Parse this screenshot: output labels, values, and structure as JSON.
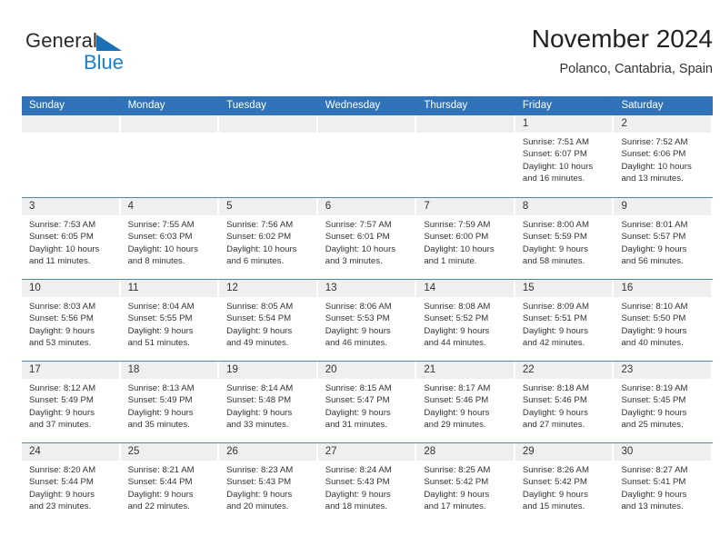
{
  "brand": {
    "name_part1": "General",
    "name_part2": "Blue",
    "triangle_color": "#1a6fb5",
    "blue_color": "#1a7fd4"
  },
  "header": {
    "title": "November 2024",
    "subtitle": "Polanco, Cantabria, Spain"
  },
  "theme": {
    "header_blue": "#3073b8",
    "row_divider": "#4f83bd",
    "daynum_band": "#efefef",
    "text": "#333333"
  },
  "weekday_headers": [
    "Sunday",
    "Monday",
    "Tuesday",
    "Wednesday",
    "Thursday",
    "Friday",
    "Saturday"
  ],
  "weeks": [
    [
      {
        "day": "",
        "lines": []
      },
      {
        "day": "",
        "lines": []
      },
      {
        "day": "",
        "lines": []
      },
      {
        "day": "",
        "lines": []
      },
      {
        "day": "",
        "lines": []
      },
      {
        "day": "1",
        "lines": [
          "Sunrise: 7:51 AM",
          "Sunset: 6:07 PM",
          "Daylight: 10 hours",
          "and 16 minutes."
        ]
      },
      {
        "day": "2",
        "lines": [
          "Sunrise: 7:52 AM",
          "Sunset: 6:06 PM",
          "Daylight: 10 hours",
          "and 13 minutes."
        ]
      }
    ],
    [
      {
        "day": "3",
        "lines": [
          "Sunrise: 7:53 AM",
          "Sunset: 6:05 PM",
          "Daylight: 10 hours",
          "and 11 minutes."
        ]
      },
      {
        "day": "4",
        "lines": [
          "Sunrise: 7:55 AM",
          "Sunset: 6:03 PM",
          "Daylight: 10 hours",
          "and 8 minutes."
        ]
      },
      {
        "day": "5",
        "lines": [
          "Sunrise: 7:56 AM",
          "Sunset: 6:02 PM",
          "Daylight: 10 hours",
          "and 6 minutes."
        ]
      },
      {
        "day": "6",
        "lines": [
          "Sunrise: 7:57 AM",
          "Sunset: 6:01 PM",
          "Daylight: 10 hours",
          "and 3 minutes."
        ]
      },
      {
        "day": "7",
        "lines": [
          "Sunrise: 7:59 AM",
          "Sunset: 6:00 PM",
          "Daylight: 10 hours",
          "and 1 minute."
        ]
      },
      {
        "day": "8",
        "lines": [
          "Sunrise: 8:00 AM",
          "Sunset: 5:59 PM",
          "Daylight: 9 hours",
          "and 58 minutes."
        ]
      },
      {
        "day": "9",
        "lines": [
          "Sunrise: 8:01 AM",
          "Sunset: 5:57 PM",
          "Daylight: 9 hours",
          "and 56 minutes."
        ]
      }
    ],
    [
      {
        "day": "10",
        "lines": [
          "Sunrise: 8:03 AM",
          "Sunset: 5:56 PM",
          "Daylight: 9 hours",
          "and 53 minutes."
        ]
      },
      {
        "day": "11",
        "lines": [
          "Sunrise: 8:04 AM",
          "Sunset: 5:55 PM",
          "Daylight: 9 hours",
          "and 51 minutes."
        ]
      },
      {
        "day": "12",
        "lines": [
          "Sunrise: 8:05 AM",
          "Sunset: 5:54 PM",
          "Daylight: 9 hours",
          "and 49 minutes."
        ]
      },
      {
        "day": "13",
        "lines": [
          "Sunrise: 8:06 AM",
          "Sunset: 5:53 PM",
          "Daylight: 9 hours",
          "and 46 minutes."
        ]
      },
      {
        "day": "14",
        "lines": [
          "Sunrise: 8:08 AM",
          "Sunset: 5:52 PM",
          "Daylight: 9 hours",
          "and 44 minutes."
        ]
      },
      {
        "day": "15",
        "lines": [
          "Sunrise: 8:09 AM",
          "Sunset: 5:51 PM",
          "Daylight: 9 hours",
          "and 42 minutes."
        ]
      },
      {
        "day": "16",
        "lines": [
          "Sunrise: 8:10 AM",
          "Sunset: 5:50 PM",
          "Daylight: 9 hours",
          "and 40 minutes."
        ]
      }
    ],
    [
      {
        "day": "17",
        "lines": [
          "Sunrise: 8:12 AM",
          "Sunset: 5:49 PM",
          "Daylight: 9 hours",
          "and 37 minutes."
        ]
      },
      {
        "day": "18",
        "lines": [
          "Sunrise: 8:13 AM",
          "Sunset: 5:49 PM",
          "Daylight: 9 hours",
          "and 35 minutes."
        ]
      },
      {
        "day": "19",
        "lines": [
          "Sunrise: 8:14 AM",
          "Sunset: 5:48 PM",
          "Daylight: 9 hours",
          "and 33 minutes."
        ]
      },
      {
        "day": "20",
        "lines": [
          "Sunrise: 8:15 AM",
          "Sunset: 5:47 PM",
          "Daylight: 9 hours",
          "and 31 minutes."
        ]
      },
      {
        "day": "21",
        "lines": [
          "Sunrise: 8:17 AM",
          "Sunset: 5:46 PM",
          "Daylight: 9 hours",
          "and 29 minutes."
        ]
      },
      {
        "day": "22",
        "lines": [
          "Sunrise: 8:18 AM",
          "Sunset: 5:46 PM",
          "Daylight: 9 hours",
          "and 27 minutes."
        ]
      },
      {
        "day": "23",
        "lines": [
          "Sunrise: 8:19 AM",
          "Sunset: 5:45 PM",
          "Daylight: 9 hours",
          "and 25 minutes."
        ]
      }
    ],
    [
      {
        "day": "24",
        "lines": [
          "Sunrise: 8:20 AM",
          "Sunset: 5:44 PM",
          "Daylight: 9 hours",
          "and 23 minutes."
        ]
      },
      {
        "day": "25",
        "lines": [
          "Sunrise: 8:21 AM",
          "Sunset: 5:44 PM",
          "Daylight: 9 hours",
          "and 22 minutes."
        ]
      },
      {
        "day": "26",
        "lines": [
          "Sunrise: 8:23 AM",
          "Sunset: 5:43 PM",
          "Daylight: 9 hours",
          "and 20 minutes."
        ]
      },
      {
        "day": "27",
        "lines": [
          "Sunrise: 8:24 AM",
          "Sunset: 5:43 PM",
          "Daylight: 9 hours",
          "and 18 minutes."
        ]
      },
      {
        "day": "28",
        "lines": [
          "Sunrise: 8:25 AM",
          "Sunset: 5:42 PM",
          "Daylight: 9 hours",
          "and 17 minutes."
        ]
      },
      {
        "day": "29",
        "lines": [
          "Sunrise: 8:26 AM",
          "Sunset: 5:42 PM",
          "Daylight: 9 hours",
          "and 15 minutes."
        ]
      },
      {
        "day": "30",
        "lines": [
          "Sunrise: 8:27 AM",
          "Sunset: 5:41 PM",
          "Daylight: 9 hours",
          "and 13 minutes."
        ]
      }
    ]
  ]
}
